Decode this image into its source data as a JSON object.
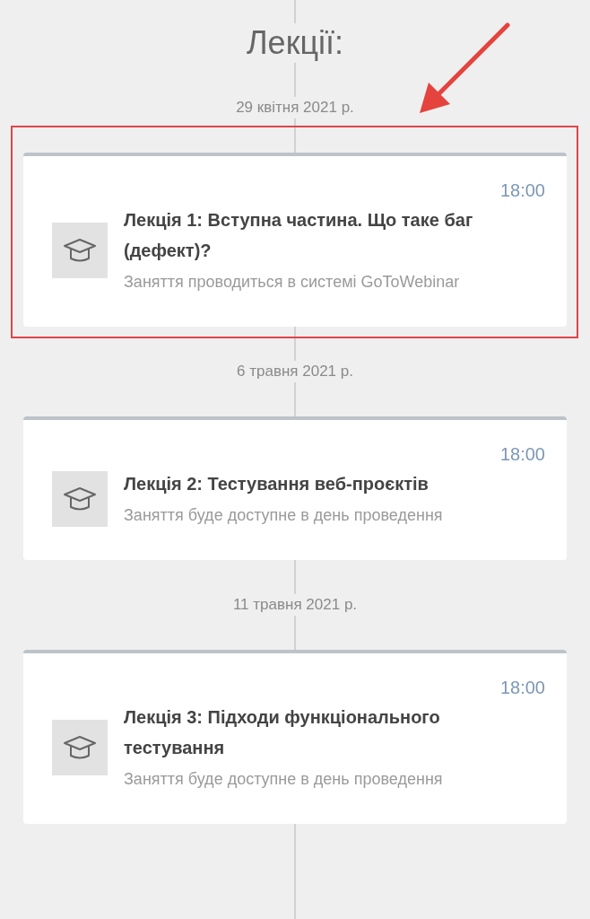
{
  "title": "Лекції:",
  "lectures": [
    {
      "date": "29 квітня 2021 р.",
      "time": "18:00",
      "title": "Лекція 1: Вступна частина. Що таке баг (дефект)?",
      "note": "Заняття проводиться в системі GoToWebinar",
      "highlighted": true
    },
    {
      "date": "6 травня 2021 р.",
      "time": "18:00",
      "title": "Лекція 2: Тестування веб-проєктів",
      "note": "Заняття буде доступне в день проведення",
      "highlighted": false
    },
    {
      "date": "11 травня 2021 р.",
      "time": "18:00",
      "title": "Лекція 3: Підходи функціонального тестування",
      "note": "Заняття буде доступне в день проведення",
      "highlighted": false
    }
  ]
}
